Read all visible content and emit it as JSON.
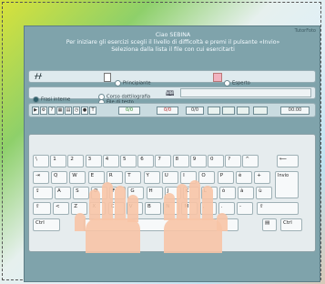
{
  "window": {
    "brand": "TutorFoto"
  },
  "message": {
    "line1": "Ciao SEBINA",
    "line2": "Per iniziare gli esercizi scegli il livello di difficoltà e premi il pulsante «Invio»",
    "line3": "Seleziona dalla lista il file con cui esercitarti"
  },
  "level": {
    "beginner_label": "Principiante",
    "expert_label": "Esperto"
  },
  "source": {
    "option1_label": "Frasi interne",
    "option2_label": "Corso dattilografia",
    "option3_label": "File di testo"
  },
  "toolbar": {
    "counter1": "0/0",
    "counter2": "0/0",
    "counter3": "0/0",
    "time": "00:00"
  },
  "keys": {
    "row1": [
      "\\",
      "1",
      "2",
      "3",
      "4",
      "5",
      "6",
      "7",
      "8",
      "9",
      "0",
      "?",
      "^"
    ],
    "row2": [
      "Q",
      "W",
      "E",
      "R",
      "T",
      "Y",
      "U",
      "I",
      "O",
      "P",
      "è",
      "+"
    ],
    "row3": [
      "A",
      "S",
      "D",
      "F",
      "G",
      "H",
      "J",
      "K",
      "L",
      "ò",
      "à",
      "ù"
    ],
    "row4": [
      "<",
      "Z",
      "X",
      "C",
      "V",
      "B",
      "N",
      "M",
      ",",
      ".",
      "-"
    ],
    "enter": "Invio",
    "ctrl_left": "Ctrl",
    "ctrl_right": "Ctrl"
  }
}
